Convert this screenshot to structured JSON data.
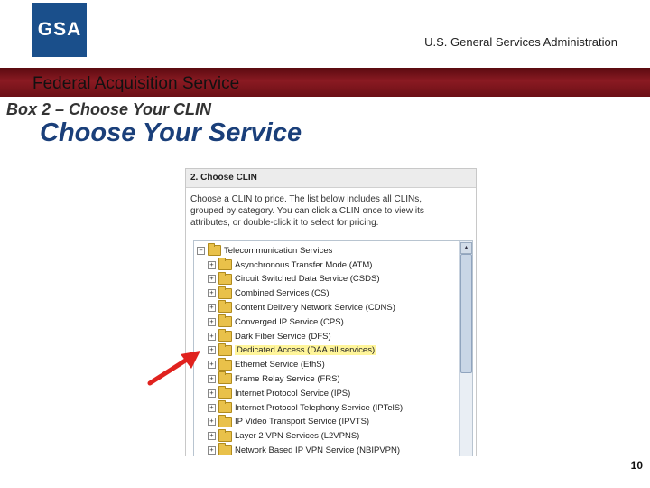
{
  "header": {
    "logo_text": "GSA",
    "agency": "U.S. General Services Administration",
    "band_title": "Federal Acquisition Service"
  },
  "slide": {
    "box_title": "Box 2 – Choose Your CLIN",
    "service_title": "Choose Your Service",
    "page_number": "10"
  },
  "panel": {
    "title": "2. Choose CLIN",
    "instruction": "Choose a CLIN to price. The list below includes all CLINs, grouped by category. You can click a CLIN once to view its attributes, or double-click it to select for pricing.",
    "tree": {
      "root": "Telecommunication Services",
      "items": [
        "Asynchronous Transfer Mode (ATM)",
        "Circuit Switched Data Service (CSDS)",
        "Combined Services (CS)",
        "Content Delivery Network Service (CDNS)",
        "Converged IP Service (CPS)",
        "Dark Fiber Service (DFS)",
        "Dedicated Access (DAA all services)",
        "Ethernet Service (EthS)",
        "Frame Relay Service (FRS)",
        "Internet Protocol Service (IPS)",
        "Internet Protocol Telephony Service (IPTelS)",
        "IP Video Transport Service (IPVTS)",
        "Layer 2 VPN Services (L2VPNS)",
        "Network Based IP VPN Service (NBIPVPN)"
      ],
      "highlighted_index": 6,
      "highlight_color": "#fff59a"
    }
  },
  "colors": {
    "band": "#7a141c",
    "logo": "#1a4f8b",
    "service_title": "#1a3f7a",
    "arrow": "#e0221e"
  }
}
